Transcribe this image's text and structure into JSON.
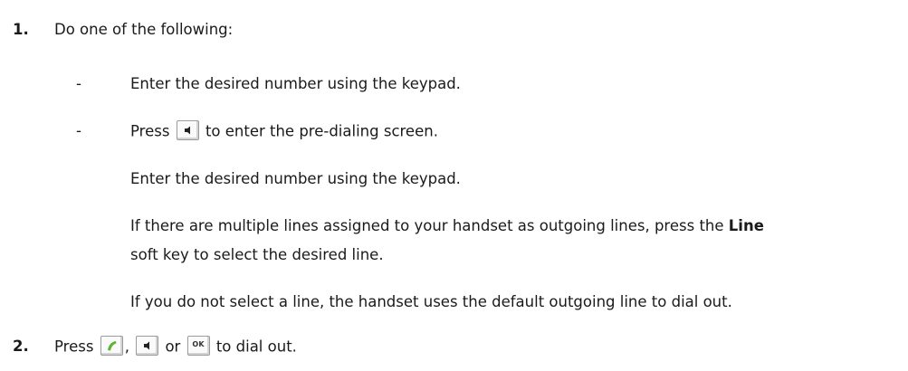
{
  "steps": [
    {
      "number": "1.",
      "text": "Do one of the following:",
      "options": [
        {
          "bullet": "-",
          "text": "Enter the desired number using the keypad."
        },
        {
          "bullet": "-",
          "text_before_icon": "Press",
          "icon": "speaker-icon",
          "text_after_icon": "to enter the pre-dialing screen.",
          "sub_paragraphs": [
            "Enter the desired number using the keypad.",
            "If there are multiple lines assigned to your handset as outgoing lines, press the",
            "soft key to select the desired line.",
            "If you do not select a line, the handset uses the default outgoing line to dial out."
          ],
          "bold_term": "Line"
        }
      ]
    },
    {
      "number": "2.",
      "text_before_icons": "Press",
      "icons": [
        "off-hook-icon",
        "speaker-icon",
        "ok-icon"
      ],
      "separator_comma": ",",
      "separator_or": "or",
      "ok_label": "OK",
      "text_after_icons": "to dial out."
    }
  ],
  "colors": {
    "text": "#1a1a1a",
    "handset_icon_accent": "#5cb531"
  }
}
